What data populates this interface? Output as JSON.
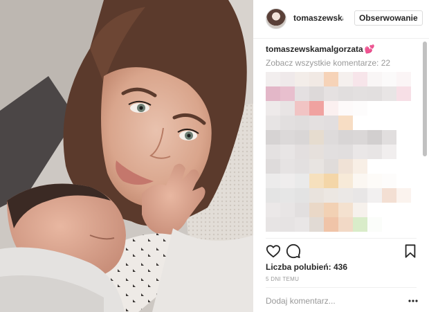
{
  "post": {
    "photo_alt": "",
    "header": {
      "username": "tomaszewskamalgorzata",
      "follow_label": "Obserwowanie"
    },
    "caption": {
      "username": "tomaszewskamalgorzata",
      "emoji": "💕"
    },
    "view_all_comments": "Zobacz wszystkie komentarze: 22",
    "likes": "Liczba polubień: 436",
    "timestamp": "5 DNI TEMU",
    "comment_input": {
      "placeholder": "Dodaj komentarz..."
    },
    "icons": {
      "like": "heart-icon",
      "comment": "comment-icon",
      "save": "bookmark-icon",
      "more": "more-options-icon"
    }
  }
}
